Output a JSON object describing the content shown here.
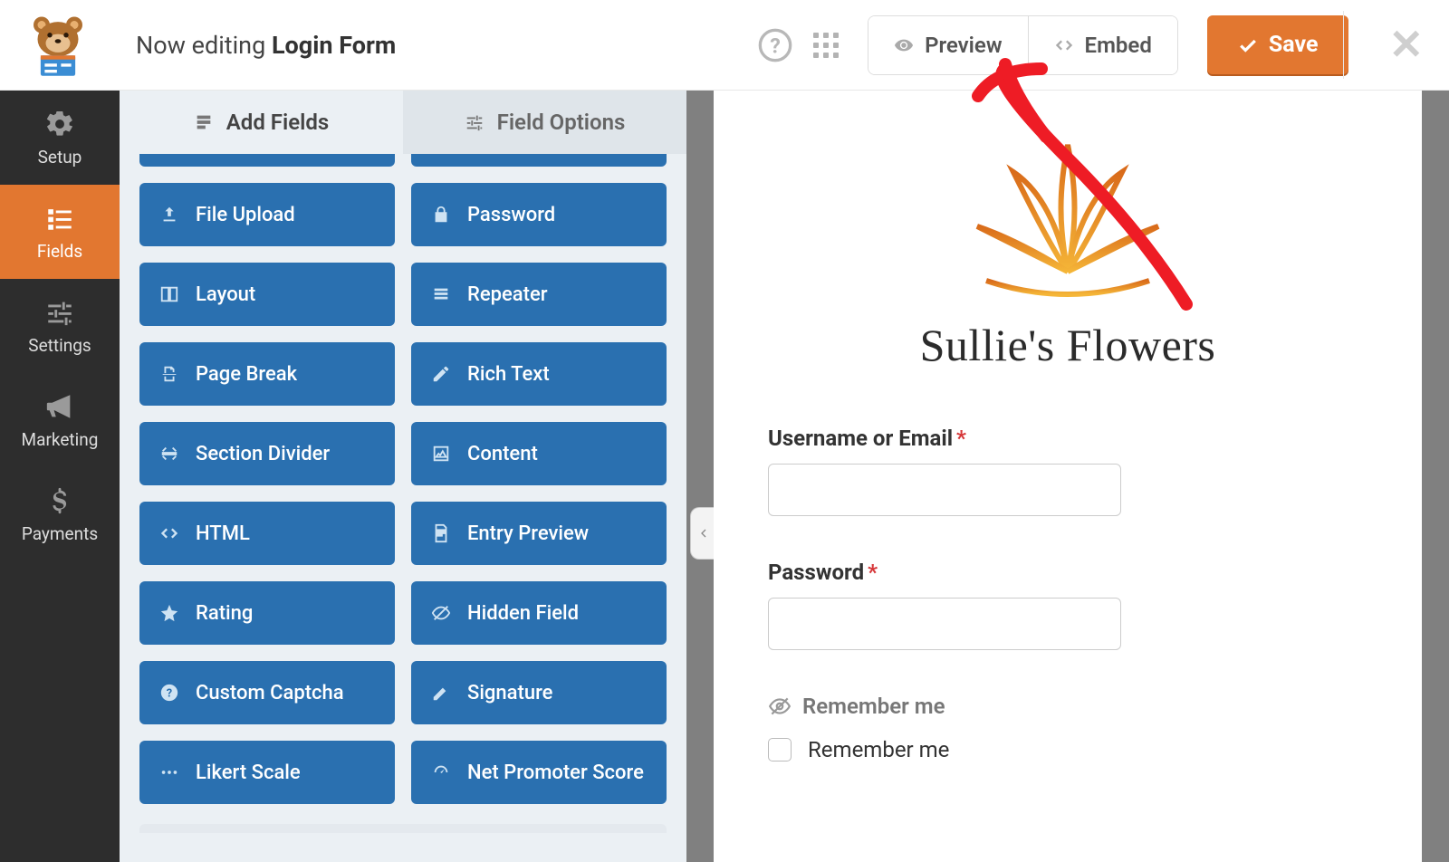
{
  "header": {
    "editing_prefix": "Now editing",
    "form_name": "Login Form",
    "preview_label": "Preview",
    "embed_label": "Embed",
    "save_label": "Save"
  },
  "sidebar": {
    "items": [
      {
        "label": "Setup"
      },
      {
        "label": "Fields"
      },
      {
        "label": "Settings"
      },
      {
        "label": "Marketing"
      },
      {
        "label": "Payments"
      }
    ]
  },
  "panel_tabs": {
    "add_fields": "Add Fields",
    "field_options": "Field Options"
  },
  "field_buttons": [
    {
      "label": "File Upload"
    },
    {
      "label": "Password"
    },
    {
      "label": "Layout"
    },
    {
      "label": "Repeater"
    },
    {
      "label": "Page Break"
    },
    {
      "label": "Rich Text"
    },
    {
      "label": "Section Divider"
    },
    {
      "label": "Content"
    },
    {
      "label": "HTML"
    },
    {
      "label": "Entry Preview"
    },
    {
      "label": "Rating"
    },
    {
      "label": "Hidden Field"
    },
    {
      "label": "Custom Captcha"
    },
    {
      "label": "Signature"
    },
    {
      "label": "Likert Scale"
    },
    {
      "label": "Net Promoter Score"
    }
  ],
  "preview": {
    "brand_name": "Sullie's Flowers",
    "username_label": "Username or Email",
    "password_label": "Password",
    "remember_head": "Remember me",
    "remember_option": "Remember me"
  },
  "colors": {
    "accent": "#e27730",
    "field_blue": "#2a70b0"
  }
}
